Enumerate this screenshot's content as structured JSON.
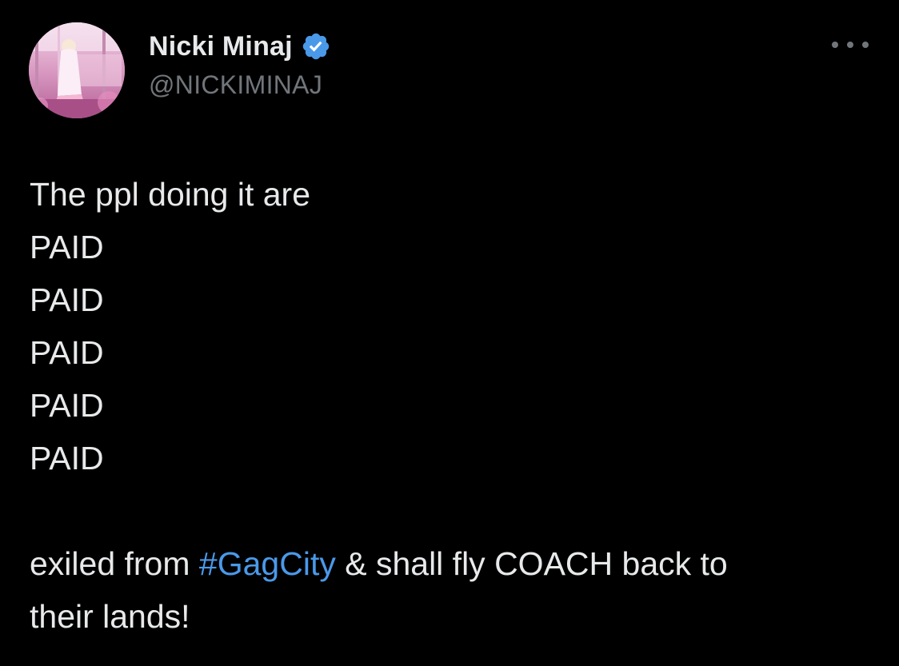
{
  "author": {
    "display_name": "Nicki Minaj",
    "handle": "@NICKIMINAJ",
    "verified": true,
    "verified_badge_color": "#4a99e9"
  },
  "icons": {
    "avatar": "profile-photo",
    "badge": "verified-badge-icon",
    "more": "more-options-icon"
  },
  "tweet": {
    "lines": [
      "The ppl doing it are",
      "PAID",
      "PAID",
      "PAID",
      "PAID",
      "PAID"
    ],
    "last_paragraph": {
      "before": "exiled from ",
      "hashtag": "#GagCity",
      "after_line1": " & shall fly COACH back to",
      "line2": "their lands!"
    }
  },
  "colors": {
    "background": "#000000",
    "text": "#e7e9ea",
    "secondary": "#71767b",
    "link": "#4a99e9"
  }
}
